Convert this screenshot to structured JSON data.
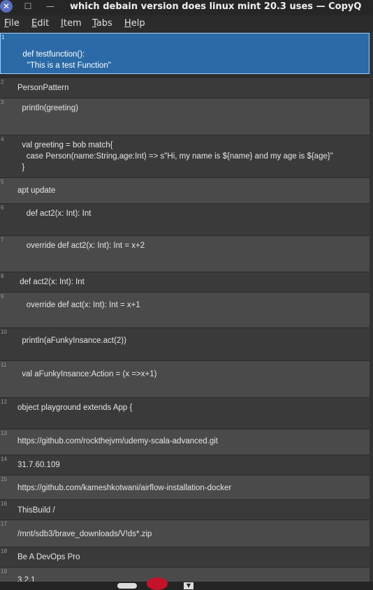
{
  "window": {
    "title": "which debain version does linux mint 20.3 uses — CopyQ",
    "close_glyph": "✕",
    "minimize_glyph": "—",
    "maximize_glyph": "☐"
  },
  "menu": [
    {
      "key": "F",
      "rest": "ile"
    },
    {
      "key": "E",
      "rest": "dit"
    },
    {
      "key": "I",
      "rest": "tem"
    },
    {
      "key": "T",
      "rest": "abs"
    },
    {
      "key": "H",
      "rest": "elp"
    }
  ],
  "items": [
    {
      "num": "1",
      "text": "  def testfunction():\n    \"This is a test Function\""
    },
    {
      "num": "2",
      "text": "PersonPattern"
    },
    {
      "num": "3",
      "text": "  println(greeting)"
    },
    {
      "num": "4",
      "text": "  val greeting = bob match{\n    case Person(name:String,age:Int) => s\"Hi, my name is ${name} and my age is ${age}\"\n  }"
    },
    {
      "num": "5",
      "text": "apt update"
    },
    {
      "num": "6",
      "text": "    def act2(x: Int): Int"
    },
    {
      "num": "7",
      "text": "    override def act2(x: Int): Int = x+2"
    },
    {
      "num": "8",
      "text": " def act2(x: Int): Int"
    },
    {
      "num": "9",
      "text": "    override def act(x: Int): Int = x+1"
    },
    {
      "num": "10",
      "text": "  println(aFunkyInsance.act(2))"
    },
    {
      "num": "11",
      "text": "  val aFunkyInsance:Action = (x =>x+1)"
    },
    {
      "num": "12",
      "text": "object playground extends App {"
    },
    {
      "num": "13",
      "text": "https://github.com/rockthejvm/udemy-scala-advanced.git"
    },
    {
      "num": "14",
      "text": "31.7.60.109"
    },
    {
      "num": "15",
      "text": "https://github.com/kameshkotwani/airflow-installation-docker"
    },
    {
      "num": "16",
      "text": "ThisBuild /"
    },
    {
      "num": "17",
      "text": "/mnt/sdb3/brave_downloads/V!ds*.zip"
    },
    {
      "num": "18",
      "text": "Be A DevOps Pro"
    },
    {
      "num": "19",
      "text": "3.2.1"
    }
  ]
}
